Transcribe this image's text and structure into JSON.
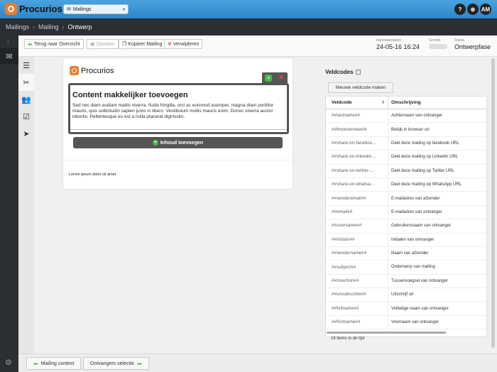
{
  "app": {
    "logo_text": "Procurios"
  },
  "selector": {
    "value": "Mailings"
  },
  "topbar": {
    "help_label": "?",
    "search_label": "⊕",
    "user_initials": "AM"
  },
  "breadcrumb": {
    "items": [
      "Mailings",
      "Mailing",
      "Ontwerp"
    ]
  },
  "toolbar": {
    "back_label": "Terug naar Overzicht",
    "save_label": "Opslaan",
    "copy_label": "Kopieer Mailing",
    "delete_label": "Verwijderen",
    "date_caption": "Aanmaakdatum",
    "date_value": "24-05-16 16:24",
    "size_caption": "Grootte",
    "status_caption": "Status",
    "status_value": "Ontwerpfase"
  },
  "editor": {
    "logo_text": "Procurios",
    "heading": "Content makkelijker toevoegen",
    "body": "Sed nec diam eudiam mattis viverra. Nulla fringilla, orci ac euismod asemper, magna diam porttitor mauris, quis sollicitudin sapien justo in libero. Vestibulum mollis mauris enim. Donec viverra auctor lobortis. Pellentesque eu est a nulla placerat dignissim.",
    "add_content_label": "Inhoud toevoegen",
    "lorem": "Lorem ipsum dolor sit amet"
  },
  "fieldcodes": {
    "title": "Veldcodes",
    "new_button": "Nieuwe veldcode maken",
    "col_code": "Veldcode",
    "col_desc": "Omschrijving",
    "rows": [
      {
        "code": "##lastname##",
        "desc": "Achternaam van ontvanger"
      },
      {
        "code": "##browserview##",
        "desc": "Bekijk in browser url"
      },
      {
        "code": "##share-on-faceboo...",
        "desc": "Deel deze mailing op facebook URL"
      },
      {
        "code": "##share-on-linkedin...",
        "desc": "Deel deze mailing op LinkedIn URL"
      },
      {
        "code": "##share-on-twitter-...",
        "desc": "Deel deze mailing op Twitter URL"
      },
      {
        "code": "##share-on-whatsa...",
        "desc": "Deel deze mailing op WhatsApp URL"
      },
      {
        "code": "##senderemail##",
        "desc": "E-mailadres van afzender"
      },
      {
        "code": "##email##",
        "desc": "E-mailadres van ontvanger"
      },
      {
        "code": "##username##",
        "desc": "Gebruikersnaam van ontvanger"
      },
      {
        "code": "##initials##",
        "desc": "Initialen van ontvanger"
      },
      {
        "code": "##sendername##",
        "desc": "Naam van afzender"
      },
      {
        "code": "##subject##",
        "desc": "Onderwerp van mailing"
      },
      {
        "code": "##insertion##",
        "desc": "Tussenvoegsel van ontvanger"
      },
      {
        "code": "##unsubscribe##",
        "desc": "Uitschrijf url"
      },
      {
        "code": "##fullname##",
        "desc": "Volledige naam van ontvanger"
      },
      {
        "code": "##firstname##",
        "desc": "Voornaam van ontvanger"
      }
    ],
    "count_text": "16 items in de lijst"
  },
  "bottom": {
    "prev_label": "Mailing context",
    "next_label": "Ontvangers selectie"
  }
}
